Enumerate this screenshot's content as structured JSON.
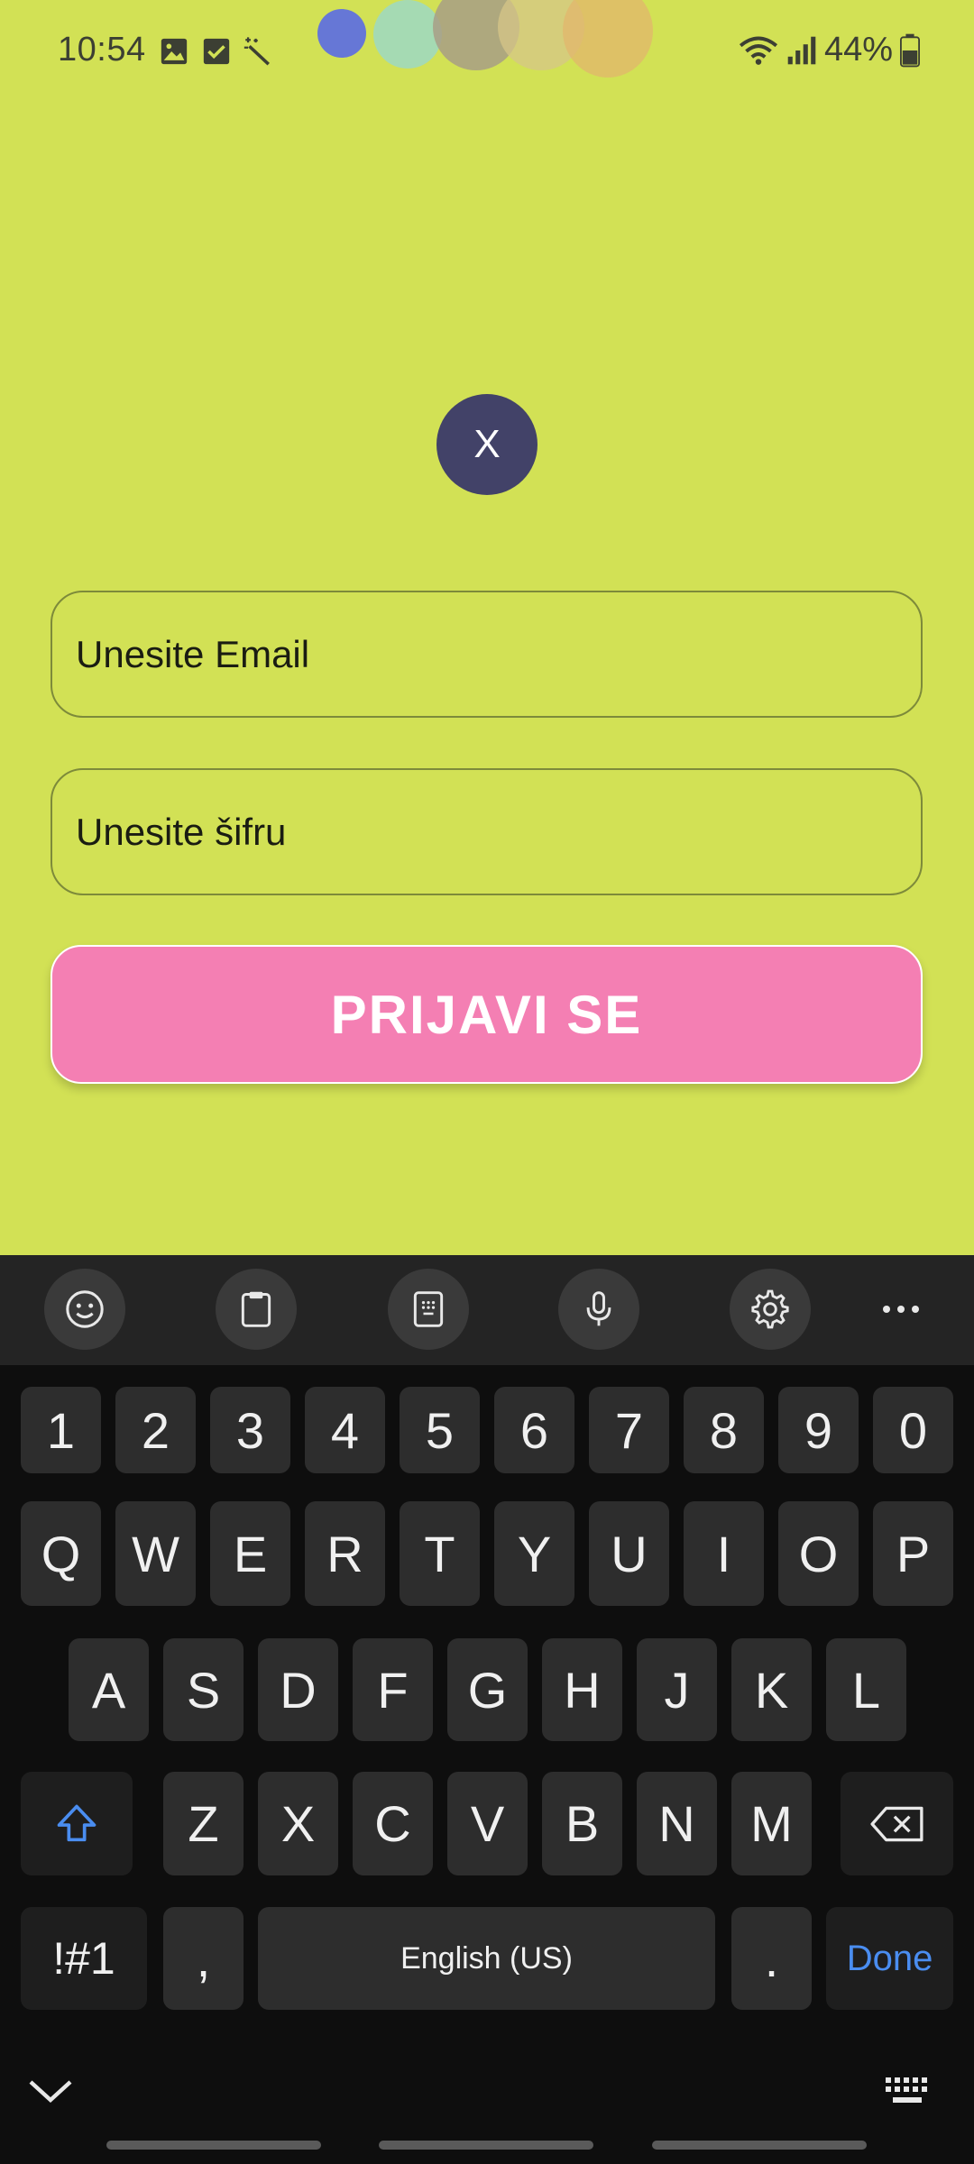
{
  "status_bar": {
    "time": "10:54",
    "battery": "44%"
  },
  "avatar": {
    "label": "X"
  },
  "login_form": {
    "email_placeholder": "Unesite Email",
    "password_placeholder": "Unesite šifru",
    "submit_label": "PRIJAVI SE"
  },
  "keyboard": {
    "number_row": [
      "1",
      "2",
      "3",
      "4",
      "5",
      "6",
      "7",
      "8",
      "9",
      "0"
    ],
    "row1": [
      "Q",
      "W",
      "E",
      "R",
      "T",
      "Y",
      "U",
      "I",
      "O",
      "P"
    ],
    "row2": [
      "A",
      "S",
      "D",
      "F",
      "G",
      "H",
      "J",
      "K",
      "L"
    ],
    "row3": [
      "Z",
      "X",
      "C",
      "V",
      "B",
      "N",
      "M"
    ],
    "symbols_label": "!#1",
    "comma_label": ",",
    "space_label": "English (US)",
    "period_label": ".",
    "done_label": "Done"
  },
  "colors": {
    "background": "#d2e155",
    "avatar": "#424268",
    "login_button": "#f47fb3",
    "keyboard_bg": "#0e0e0e",
    "done_accent": "#4a8df0"
  }
}
